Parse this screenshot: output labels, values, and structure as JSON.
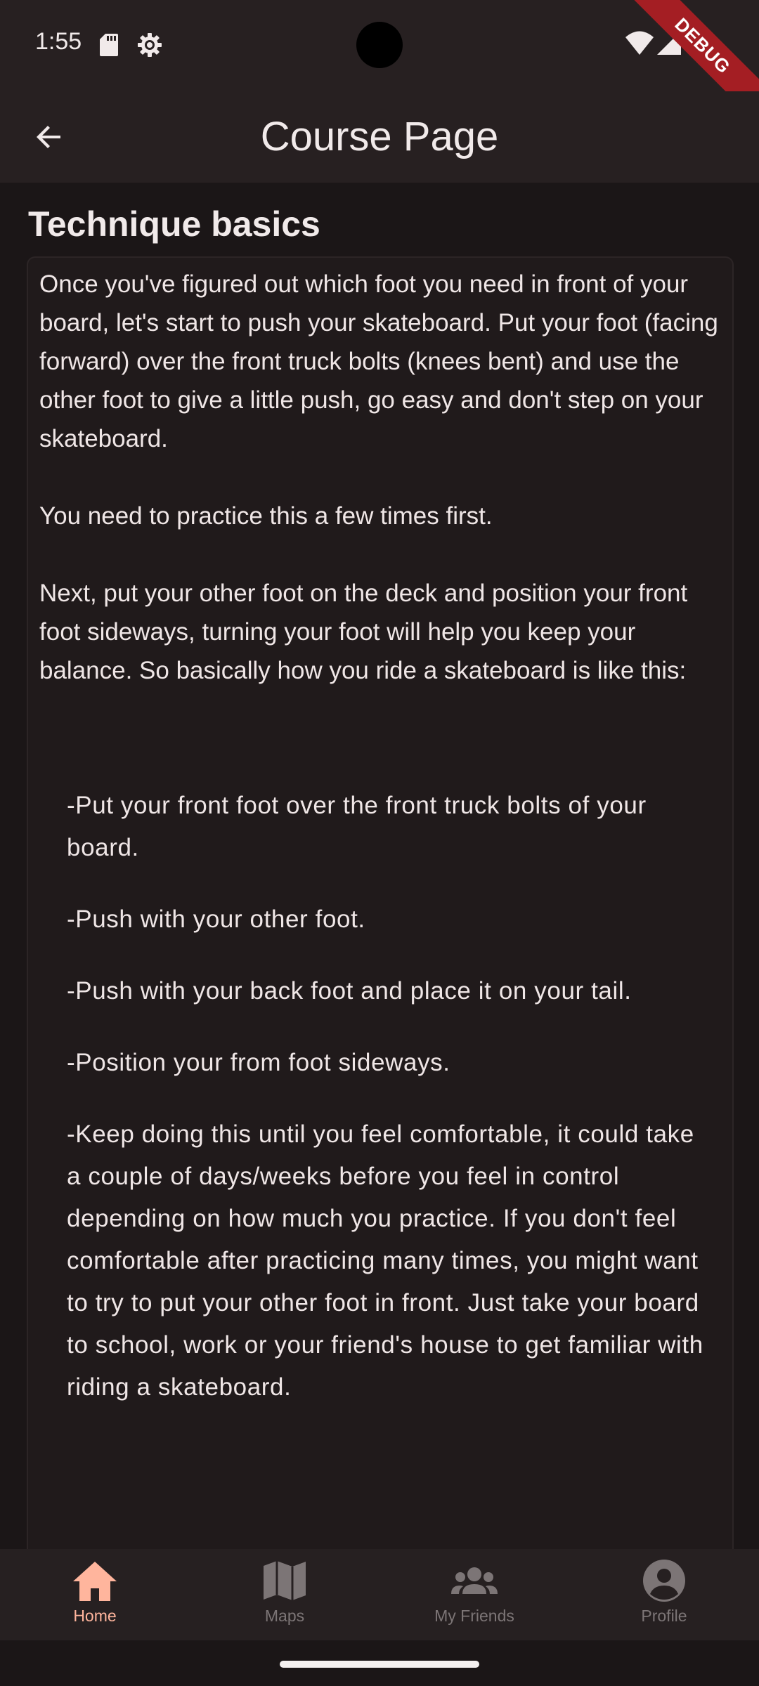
{
  "status_bar": {
    "time": "1:55",
    "icons": [
      "sd-card-icon",
      "settings-icon",
      "wifi-icon",
      "signal-icon",
      "battery-icon"
    ]
  },
  "debug_banner": "DEBUG",
  "app_bar": {
    "back_icon": "arrow-back-icon",
    "title": "Course Page"
  },
  "section": {
    "title": "Technique basics",
    "paragraphs": [
      "Once you've figured out which foot you need in front of your board, let's start to push your skateboard. Put your foot (facing forward) over the front truck bolts (knees bent) and use the other foot to give a little push, go easy and don't step on your skateboard.",
      "You need to practice this a few times first.",
      "Next, put your other foot on the deck and position your front foot sideways, turning your foot will help you keep your balance. So basically how you ride a skateboard is like this:"
    ],
    "bullets": [
      "-Put your front foot over the front truck bolts of your board.",
      "-Push with your other foot.",
      "-Push with your back foot and place it on your tail.",
      "-Position your from foot sideways.",
      "-Keep doing this until you feel comfortable, it could take a couple of days/weeks before you feel in control depending on how much you practice. If you don't feel comfortable after practicing many times, you might want to try to put your other foot in front. Just take your board to school, work or your friend's house to get familiar with riding a skateboard."
    ]
  },
  "bottom_nav": {
    "items": [
      {
        "label": "Home",
        "icon": "home-icon",
        "active": true
      },
      {
        "label": "Maps",
        "icon": "map-icon",
        "active": false
      },
      {
        "label": "My Friends",
        "icon": "group-icon",
        "active": false
      },
      {
        "label": "Profile",
        "icon": "account-circle-icon",
        "active": false
      }
    ]
  },
  "colors": {
    "background": "#1b1617",
    "app_bar": "#272021",
    "text": "#efe6e6",
    "nav_active": "#ffb59d",
    "nav_inactive": "#7c7576",
    "debug_banner": "#a41e23"
  }
}
